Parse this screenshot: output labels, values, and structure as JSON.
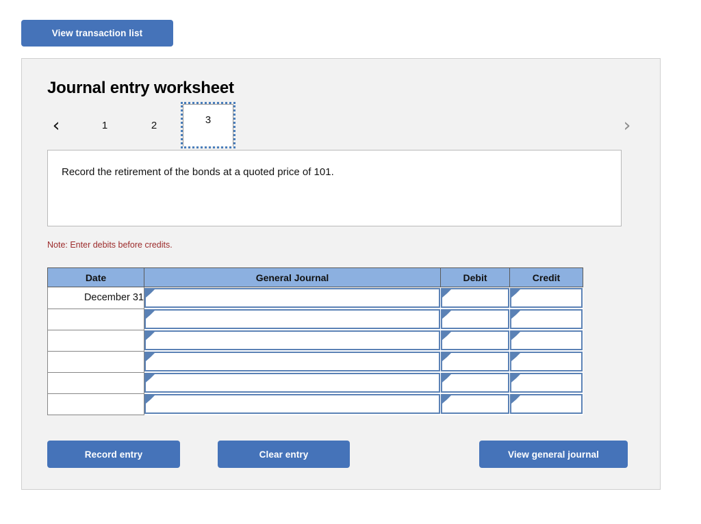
{
  "colors": {
    "button_blue": "#4573b9",
    "header_blue": "#8cb0e0",
    "input_border_blue": "#5a81b5",
    "note_red": "#9c2b2b",
    "panel_bg": "#f2f2f2",
    "tab_focus_outline": "#4a7ebb"
  },
  "toolbar": {
    "view_transaction_list_label": "View transaction list"
  },
  "worksheet": {
    "title": "Journal entry worksheet",
    "nav": {
      "prev_icon": "‹",
      "next_icon": "›",
      "prev_name": "previous",
      "next_name": "next"
    },
    "tabs": [
      {
        "label": "1",
        "selected": false
      },
      {
        "label": "2",
        "selected": false
      },
      {
        "label": "3",
        "selected": true
      }
    ],
    "instruction": "Record the retirement of the bonds at a quoted price of 101.",
    "note": "Note: Enter debits before credits."
  },
  "table": {
    "headers": [
      "Date",
      "General Journal",
      "Debit",
      "Credit"
    ],
    "rows": [
      {
        "date": "December 31",
        "general_journal": "",
        "debit": "",
        "credit": ""
      },
      {
        "date": "",
        "general_journal": "",
        "debit": "",
        "credit": ""
      },
      {
        "date": "",
        "general_journal": "",
        "debit": "",
        "credit": ""
      },
      {
        "date": "",
        "general_journal": "",
        "debit": "",
        "credit": ""
      },
      {
        "date": "",
        "general_journal": "",
        "debit": "",
        "credit": ""
      },
      {
        "date": "",
        "general_journal": "",
        "debit": "",
        "credit": ""
      }
    ]
  },
  "actions": {
    "record_entry_label": "Record entry",
    "clear_entry_label": "Clear entry",
    "view_general_journal_label": "View general journal"
  }
}
